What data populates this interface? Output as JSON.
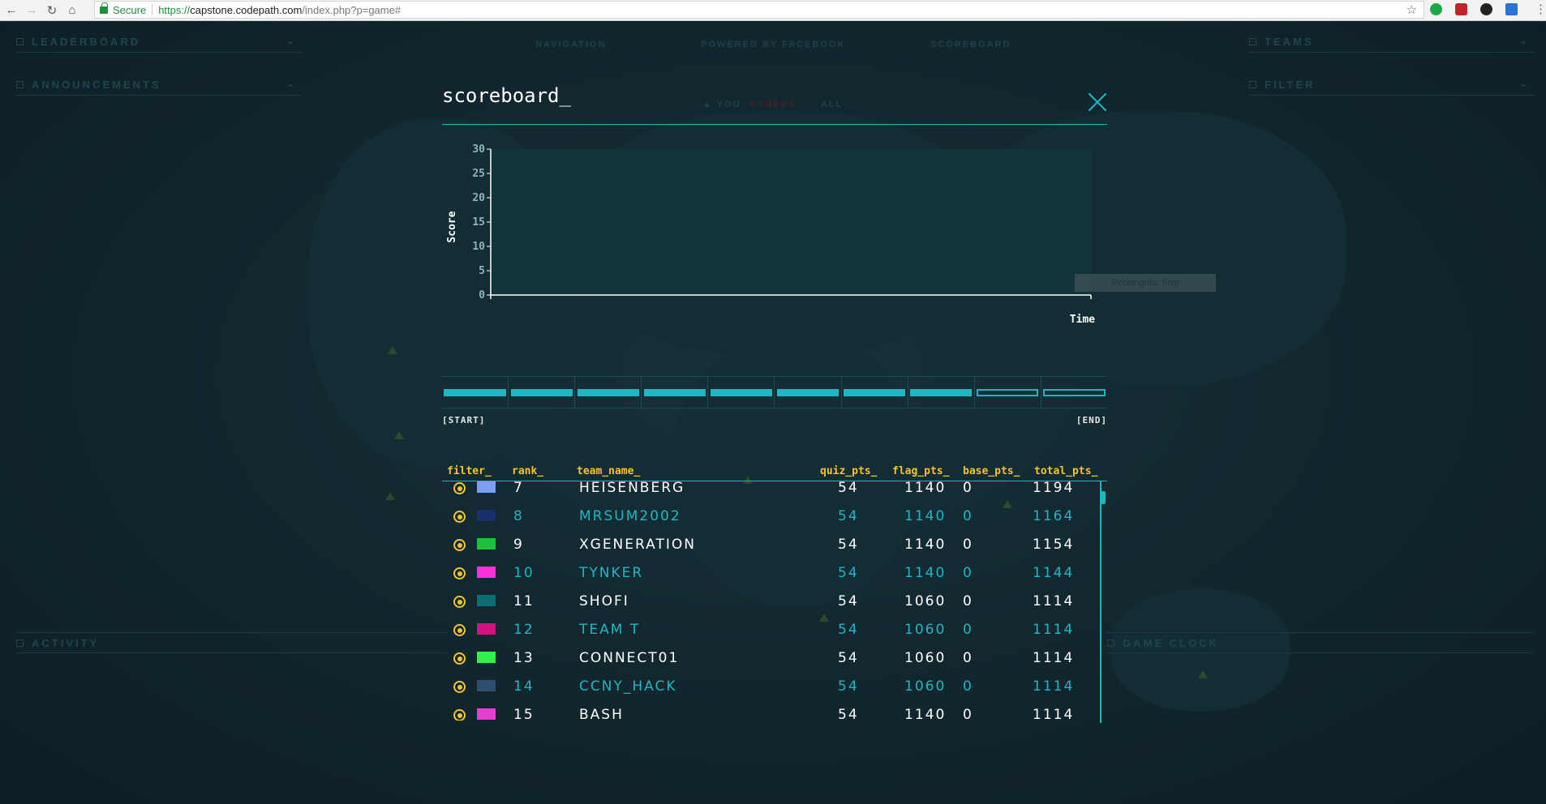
{
  "browser": {
    "secure_label": "Secure",
    "url_scheme": "https://",
    "url_host": "capstone.codepath.com",
    "url_path": "/index.php?p=game#"
  },
  "side_panels": {
    "leaderboard": "LEADERBOARD",
    "announcements": "ANNOUNCEMENTS",
    "teams": "TEAMS",
    "filter": "FILTER",
    "activity": "ACTIVITY",
    "game_clock": "GAME CLOCK"
  },
  "top_nav": {
    "navigation": "NAVIGATION",
    "powered": "POWERED BY FACEBOOK",
    "scoreboard": "SCOREBOARD",
    "you": "▲ YOU",
    "others": "OTHERS",
    "all": "ALL"
  },
  "modal": {
    "title": "scoreboard_",
    "snip_label": "Rectangular Snip"
  },
  "chart_data": {
    "type": "line",
    "title": "",
    "xlabel": "Time",
    "ylabel": "Score",
    "ylim": [
      0,
      30
    ],
    "yticks": [
      "0",
      "5",
      "10",
      "15",
      "20",
      "25",
      "30"
    ],
    "series": []
  },
  "timeline": {
    "start_label": "[START]",
    "end_label": "[END]",
    "segments_filled": 8,
    "segments_total": 10
  },
  "table": {
    "headers": {
      "filter": "filter_",
      "rank": "rank_",
      "team_name": "team_name_",
      "quiz_pts": "quiz_pts_",
      "flag_pts": "flag_pts_",
      "base_pts": "base_pts_",
      "total_pts": "total_pts_"
    },
    "rows": [
      {
        "rank": "7",
        "team": "HEISENBERG",
        "quiz": "54",
        "flag": "1140",
        "base": "0",
        "total": "1194",
        "color": "#7b9ff0"
      },
      {
        "rank": "8",
        "team": "MRSUM2002",
        "quiz": "54",
        "flag": "1140",
        "base": "0",
        "total": "1164",
        "color": "#1a2f6b"
      },
      {
        "rank": "9",
        "team": "XGENERATION",
        "quiz": "54",
        "flag": "1140",
        "base": "0",
        "total": "1154",
        "color": "#1ec23a"
      },
      {
        "rank": "10",
        "team": "TYNKER",
        "quiz": "54",
        "flag": "1140",
        "base": "0",
        "total": "1144",
        "color": "#ff2fd8"
      },
      {
        "rank": "11",
        "team": "SHOFI",
        "quiz": "54",
        "flag": "1060",
        "base": "0",
        "total": "1114",
        "color": "#0f6e72"
      },
      {
        "rank": "12",
        "team": "TEAM T",
        "quiz": "54",
        "flag": "1060",
        "base": "0",
        "total": "1114",
        "color": "#d4117f"
      },
      {
        "rank": "13",
        "team": "CONNECT01",
        "quiz": "54",
        "flag": "1060",
        "base": "0",
        "total": "1114",
        "color": "#35f04a"
      },
      {
        "rank": "14",
        "team": "CCNY_HACK",
        "quiz": "54",
        "flag": "1060",
        "base": "0",
        "total": "1114",
        "color": "#2d5070"
      },
      {
        "rank": "15",
        "team": "BASH",
        "quiz": "54",
        "flag": "1140",
        "base": "0",
        "total": "1114",
        "color": "#e43fd1"
      }
    ]
  },
  "colors": {
    "accent": "#1fb7c2",
    "header_yellow": "#f4c430",
    "background": "#0f2228"
  }
}
